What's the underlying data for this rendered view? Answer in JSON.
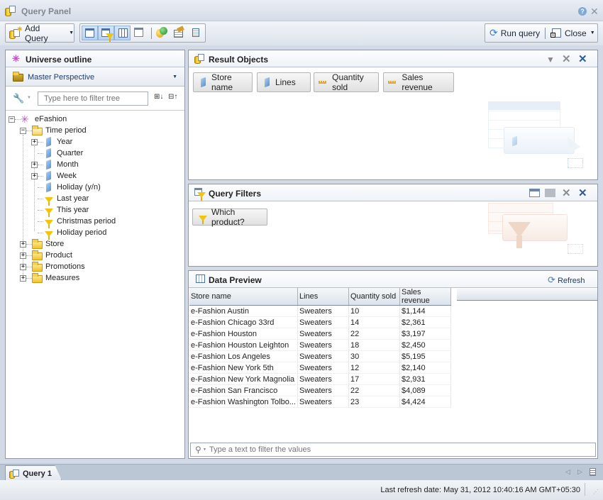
{
  "window": {
    "title": "Query Panel",
    "help_icon": "help-icon",
    "close_icon": "close-icon"
  },
  "toolbar": {
    "add_query": "Add Query",
    "run_query": "Run query",
    "close": "Close",
    "view_buttons": [
      "result-objects-view",
      "query-filters-view",
      "data-preview-view",
      "combined-view"
    ],
    "tools": [
      "combined-query",
      "query-properties",
      "view-script"
    ]
  },
  "universe_outline": {
    "title": "Universe outline",
    "perspective": "Master Perspective",
    "filter_placeholder": "Type here to filter tree",
    "tree": [
      {
        "label": "eFashion",
        "type": "universe",
        "level": 0,
        "expander": "minus"
      },
      {
        "label": "Time period",
        "type": "folder-open",
        "level": 1,
        "expander": "minus"
      },
      {
        "label": "Year",
        "type": "dimension",
        "level": 2,
        "expander": "plus"
      },
      {
        "label": "Quarter",
        "type": "dimension",
        "level": 2,
        "expander": ""
      },
      {
        "label": "Month",
        "type": "dimension",
        "level": 2,
        "expander": "plus"
      },
      {
        "label": "Week",
        "type": "dimension",
        "level": 2,
        "expander": "plus"
      },
      {
        "label": "Holiday (y/n)",
        "type": "dimension",
        "level": 2,
        "expander": ""
      },
      {
        "label": "Last year",
        "type": "filter",
        "level": 2,
        "expander": ""
      },
      {
        "label": "This year",
        "type": "filter",
        "level": 2,
        "expander": ""
      },
      {
        "label": "Christmas period",
        "type": "filter",
        "level": 2,
        "expander": ""
      },
      {
        "label": "Holiday period",
        "type": "filter",
        "level": 2,
        "expander": ""
      },
      {
        "label": "Store",
        "type": "folder",
        "level": 1,
        "expander": "plus"
      },
      {
        "label": "Product",
        "type": "folder",
        "level": 1,
        "expander": "plus"
      },
      {
        "label": "Promotions",
        "type": "folder",
        "level": 1,
        "expander": "plus"
      },
      {
        "label": "Measures",
        "type": "folder",
        "level": 1,
        "expander": "plus"
      }
    ]
  },
  "result_objects": {
    "title": "Result Objects",
    "objects": [
      {
        "label": "Store name",
        "type": "dimension"
      },
      {
        "label": "Lines",
        "type": "dimension"
      },
      {
        "label": "Quantity sold",
        "type": "measure"
      },
      {
        "label": "Sales revenue",
        "type": "measure"
      }
    ]
  },
  "query_filters": {
    "title": "Query Filters",
    "filters": [
      {
        "label": "Which product?",
        "type": "filter"
      }
    ]
  },
  "data_preview": {
    "title": "Data Preview",
    "refresh": "Refresh",
    "columns": [
      "Store name",
      "Lines",
      "Quantity sold",
      "Sales revenue"
    ],
    "rows": [
      [
        "e-Fashion Austin",
        "Sweaters",
        "10",
        "$1,144"
      ],
      [
        "e-Fashion Chicago 33rd",
        "Sweaters",
        "14",
        "$2,361"
      ],
      [
        "e-Fashion Houston",
        "Sweaters",
        "22",
        "$3,197"
      ],
      [
        "e-Fashion Houston Leighton",
        "Sweaters",
        "18",
        "$2,450"
      ],
      [
        "e-Fashion Los Angeles",
        "Sweaters",
        "30",
        "$5,195"
      ],
      [
        "e-Fashion New York 5th",
        "Sweaters",
        "12",
        "$2,140"
      ],
      [
        "e-Fashion New York Magnolia",
        "Sweaters",
        "17",
        "$2,931"
      ],
      [
        "e-Fashion San Francisco",
        "Sweaters",
        "22",
        "$4,089"
      ],
      [
        "e-Fashion Washington Tolbo...",
        "Sweaters",
        "23",
        "$4,424"
      ]
    ],
    "filter_placeholder": "Type a text to filter the values"
  },
  "tabs": [
    {
      "label": "Query 1",
      "active": true
    }
  ],
  "status": {
    "last_refresh": "Last refresh date: May 31, 2012 10:40:16 AM GMT+05:30"
  },
  "colors": {
    "accent": "#3a6ea5",
    "filter_yellow": "#f2c40c",
    "measure_orange": "#e8a33a",
    "dimension_blue": "#6ea0d8"
  }
}
